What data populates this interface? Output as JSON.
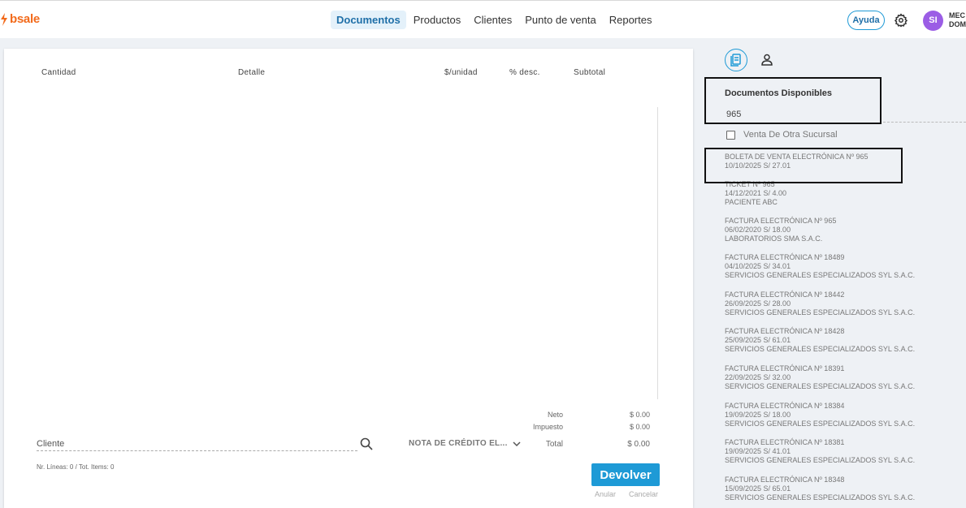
{
  "brand": {
    "name": "bsale",
    "color": "#f26a1b"
  },
  "nav": {
    "items": [
      {
        "label": "Documentos",
        "active": true
      },
      {
        "label": "Productos",
        "active": false
      },
      {
        "label": "Clientes",
        "active": false
      },
      {
        "label": "Punto de venta",
        "active": false
      },
      {
        "label": "Reportes",
        "active": false
      }
    ]
  },
  "header": {
    "help_label": "Ayuda",
    "settings_icon": "gear-icon",
    "avatar_initials": "SI",
    "avatar_color": "#9b5de5",
    "user_line1": "MEC",
    "user_line2": "DOM"
  },
  "table": {
    "columns": [
      "Cantidad",
      "Detalle",
      "$/unidad",
      "% desc.",
      "Subtotal"
    ]
  },
  "totals": {
    "neto_label": "Neto",
    "neto_value": "$ 0.00",
    "impuesto_label": "Impuesto",
    "impuesto_value": "$ 0.00",
    "total_label": "Total",
    "total_value": "$ 0.00"
  },
  "footer": {
    "client_placeholder": "Cliente",
    "doc_type": "NOTA DE CRÉDITO EL...",
    "lines_info": "Nr. Líneas: 0 / Tot. Items: 0",
    "submit_label": "Devolver",
    "void_label": "Anular",
    "cancel_label": "Cancelar",
    "accent_color": "#1e9ad6"
  },
  "side_panel": {
    "title": "Documentos Disponibles",
    "search_value": "965",
    "checkbox_label": "Venta De Otra Sucursal",
    "checkbox_checked": false,
    "documents": [
      {
        "line1": "BOLETA DE VENTA ELECTRÓNICA Nº 965",
        "line2": "10/10/2025 S/ 27.01",
        "line3": ""
      },
      {
        "line1": "TICKET Nº 965",
        "line2": "14/12/2021 S/ 4.00",
        "line3": "PACIENTE ABC"
      },
      {
        "line1": "FACTURA ELECTRÓNICA Nº 965",
        "line2": "06/02/2020 S/ 18.00",
        "line3": "LABORATORIOS SMA S.A.C."
      },
      {
        "line1": "FACTURA ELECTRÓNICA Nº 18489",
        "line2": "04/10/2025 S/ 34.01",
        "line3": "SERVICIOS GENERALES ESPECIALIZADOS SYL S.A.C."
      },
      {
        "line1": "FACTURA ELECTRÓNICA Nº 18442",
        "line2": "26/09/2025 S/ 28.00",
        "line3": "SERVICIOS GENERALES ESPECIALIZADOS SYL S.A.C."
      },
      {
        "line1": "FACTURA ELECTRÓNICA Nº 18428",
        "line2": "25/09/2025 S/ 61.01",
        "line3": "SERVICIOS GENERALES ESPECIALIZADOS SYL S.A.C."
      },
      {
        "line1": "FACTURA ELECTRÓNICA Nº 18391",
        "line2": "22/09/2025 S/ 32.00",
        "line3": "SERVICIOS GENERALES ESPECIALIZADOS SYL S.A.C."
      },
      {
        "line1": "FACTURA ELECTRÓNICA Nº 18384",
        "line2": "19/09/2025 S/ 18.00",
        "line3": "SERVICIOS GENERALES ESPECIALIZADOS SYL S.A.C."
      },
      {
        "line1": "FACTURA ELECTRÓNICA Nº 18381",
        "line2": "19/09/2025 S/ 41.01",
        "line3": "SERVICIOS GENERALES ESPECIALIZADOS SYL S.A.C."
      },
      {
        "line1": "FACTURA ELECTRÓNICA Nº 18348",
        "line2": "15/09/2025 S/ 65.01",
        "line3": "SERVICIOS GENERALES ESPECIALIZADOS SYL S.A.C."
      }
    ]
  }
}
